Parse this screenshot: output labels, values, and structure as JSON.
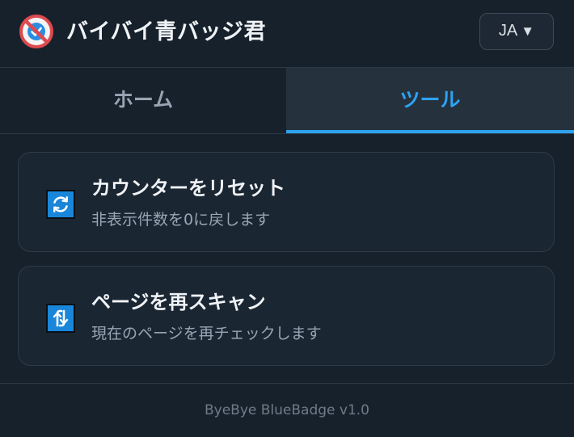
{
  "header": {
    "title": "バイバイ青バッジ君",
    "logo_icon": "no-bluebadge-logo-icon",
    "language": {
      "selected": "JA",
      "arrow": "▼"
    }
  },
  "tabs": [
    {
      "label": "ホーム",
      "active": false
    },
    {
      "label": "ツール",
      "active": true
    }
  ],
  "tools": [
    {
      "title": "カウンターをリセット",
      "description": "非表示件数を0に戻します",
      "icon": "refresh-icon"
    },
    {
      "title": "ページを再スキャン",
      "description": "現在のページを再チェックします",
      "icon": "rescan-icon"
    }
  ],
  "footer": {
    "version_text": "ByeBye BlueBadge v1.0"
  },
  "colors": {
    "background": "#17212c",
    "accent": "#2ea3f2",
    "card_background": "#1b2633",
    "icon_blue": "#1a86d9",
    "logo_red": "#e0454a"
  }
}
